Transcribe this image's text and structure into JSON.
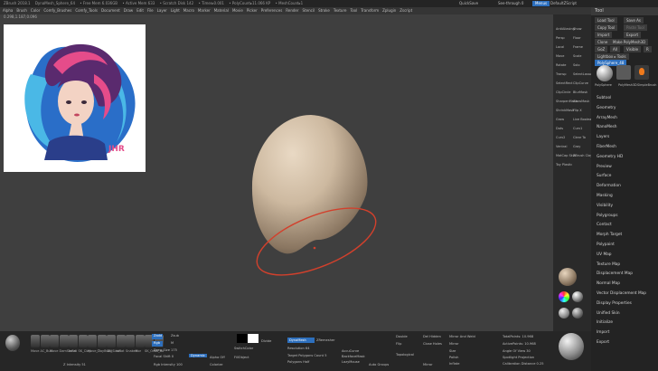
{
  "titlebar": {
    "app": "ZBrush 2018.1",
    "items": [
      "DynaMesh_Sphere_64",
      "• Free Mem 6.036GB",
      "• Active Mem 633",
      "• Scratch Disk 142",
      "• Timer▸0.001",
      "• PolyCount▸11.066 KP",
      "• MeshCount▸1"
    ],
    "quicksave": "QuickSave",
    "see_through": "See-through 0",
    "menus": "Menus",
    "default_zscript": "DefaultZScript"
  },
  "menubar": [
    "Alpha",
    "Brush",
    "Color",
    "Comfy_Brushes",
    "Comfy_Tools",
    "Document",
    "Draw",
    "Edit",
    "File",
    "Layer",
    "Light",
    "Macro",
    "Marker",
    "Material",
    "Movie",
    "Picker",
    "Preferences",
    "Render",
    "Stencil",
    "Stroke",
    "Texture",
    "Tool",
    "Transform",
    "Zplugin",
    "Zscript"
  ],
  "coords": "0.298,1.187,0.096",
  "ref_image": {
    "signature": "JHR",
    "colors": [
      "#e54c8a",
      "#2a6ec8",
      "#4ab8e6",
      "#5a2a6e"
    ]
  },
  "colors": {
    "mesh_light": "#d3c2ac",
    "mesh_dark": "#5c4f41",
    "gizmo_ring": "#d2402c",
    "accent_blue": "#2d6fbd"
  },
  "toolstrip": [
    {
      "icon": "sphere-icon",
      "label": "AAHalf"
    },
    {
      "icon": "grid-icon",
      "label": "Persp"
    },
    {
      "icon": "scale-icon",
      "label": "Floor"
    },
    {
      "icon": "frame-icon",
      "label": "Frame"
    },
    {
      "icon": "move-icon",
      "label": "Move"
    },
    {
      "icon": "rotate-icon",
      "label": "Rotate"
    },
    {
      "icon": "scale-icon",
      "label": "Scale"
    },
    {
      "icon": "polyf-icon",
      "label": "PolyF"
    },
    {
      "icon": "transp-icon",
      "label": "Transp"
    },
    {
      "icon": "solo-icon",
      "label": "Solo"
    }
  ],
  "tool_panel": {
    "title": "Tool",
    "load_tool": "Load Tool",
    "save_as": "Save As",
    "copy_tool": "Copy Tool",
    "paste_tool": "Paste Tool",
    "import": "Import",
    "export": "Export",
    "clone": "Clone",
    "make_polymesh": "Make PolyMesh3D",
    "goz": "GoZ",
    "all": "All",
    "visible": "Visible",
    "r": "R",
    "lightbox_tools": "Lightbox ▸ Tools",
    "polysphere": "PolySphere_48",
    "subtools": [
      "PolySphere",
      "PolyMesh3D",
      "SimpleBrush"
    ],
    "sections": [
      "Subtool",
      "Geometry",
      "ArrayMesh",
      "NanoMesh",
      "Layers",
      "FiberMesh",
      "Geometry HD",
      "Preview",
      "Surface",
      "Deformation",
      "Masking",
      "Visibility",
      "Polygroups",
      "Contact",
      "Morph Target",
      "Polypaint",
      "UV Map",
      "Texture Map",
      "Displacement Map",
      "Normal Map",
      "Vector Displacement Map",
      "Display Properties",
      "Unified Skin",
      "Initialize",
      "Import",
      "Export"
    ]
  },
  "strip_items": [
    "AntiAliasing",
    "Show",
    "Persp",
    "Floor",
    "Local",
    "Frame",
    "Move",
    "Scale",
    "Rotate",
    "Solo",
    "Transp",
    "SelectLasso",
    "SelectRect",
    "ClipCurve",
    "ClipCircle",
    "BlurMask",
    "SharpenMask",
    "GrowMask",
    "ShrinkMask",
    "Flip X",
    "Grow",
    "Live Boolean",
    "Dots",
    "Curv1",
    "Curv2",
    "Clear To",
    "Ventral",
    "Gray",
    "MatCap Skin",
    "ZBrush Clay",
    "Toy Plastic"
  ],
  "shelf": {
    "brushes": [
      "Move",
      "AC_Buil",
      "Move",
      "DamStand",
      "Inflat",
      "SK_Clay",
      "Move_T",
      "ClayBuild",
      "SK_Slash",
      "Inflat",
      "SnakeH",
      "Mor",
      "SK_Orb",
      "SK_Ao"
    ],
    "zadd": "Zadd",
    "zsub": "Zsub",
    "rgb": "Rgb",
    "m": "M",
    "draw_size": "Draw Size 175",
    "focal_shift": "Focal Shift 0",
    "intensity": "Z Intensity 51",
    "rgb_intensity": "Rgb Intensity 100",
    "dynamic": "Dynamic",
    "switch_color": "SwitchColor",
    "fill_object": "FillObject",
    "divide": "Divide",
    "dynamesh": "DynaMesh",
    "resolution": "Resolution 64",
    "zremesher": "ZRemesher",
    "target_polygons": "Target Polygons Count 5",
    "polygons_half": "Polygons Half",
    "accucurve": "AccuCurve",
    "backface": "BackfaceMask",
    "lazymouse": "LazyMouse",
    "auto_groups": "Auto Groups",
    "double": "Double",
    "flip": "Flip",
    "topological": "Topological",
    "del_hidden": "Del Hidden",
    "close_holes": "Close Holes",
    "mirror_weld": "Mirror And Weld",
    "mirror": "Mirror",
    "size": "Size",
    "inflate": "Inflate",
    "total_points": "TotalPoints: 10.968",
    "active_points": "ActivePoints: 10.968",
    "angle_of_view": "Angle Of View 30",
    "spotlight_projection": "Spotlight Projection",
    "calibration_distance": "Calibration Distance 0.25",
    "colorize": "Colorize",
    "alpha_off": "Alpha Off",
    "polish": "Polish",
    "mirror2": "Mirror"
  }
}
